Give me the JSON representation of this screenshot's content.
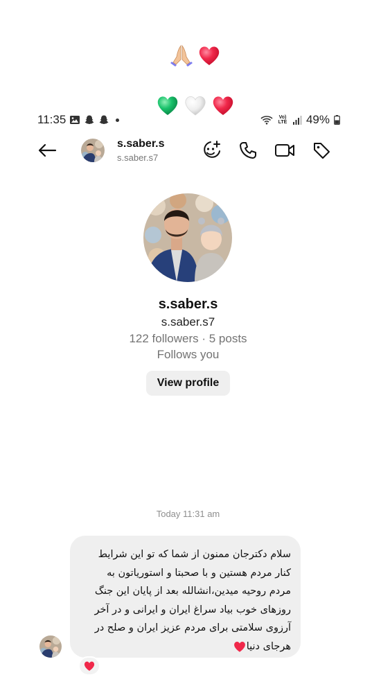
{
  "overlay": {
    "row1": [
      "folded-hands",
      "red-heart"
    ],
    "row2": [
      "green-heart",
      "white-heart",
      "red-heart"
    ]
  },
  "status_bar": {
    "time": "11:35",
    "left_icons": [
      "gallery-icon",
      "snapchat-icon",
      "snapchat-icon",
      "dot"
    ],
    "network": "Vo) LTE",
    "battery": "49%"
  },
  "header": {
    "name": "s.saber.s",
    "handle": "s.saber.s7",
    "actions": [
      "add-sticker-icon",
      "phone-icon",
      "video-icon",
      "tag-icon"
    ]
  },
  "profile": {
    "name": "s.saber.s",
    "handle": "s.saber.s7",
    "stats": "122 followers · 5 posts",
    "follows": "Follows you",
    "view_profile_label": "View profile"
  },
  "chat": {
    "timestamp": "Today 11:31 am",
    "message": "سلام دکترجان ممنون از شما که تو این شرایط کنار مردم هستین و با صحبتا و استوریاتون به مردم روحیه میدین،انشالله بعد از پایان این جنگ روزهای خوب بیاد سراغ ایران و ایرانی و در آخر آرزوی سلامتی برای مردم عزیز ایران و صلح در هرجای دنیا",
    "reaction": "red-heart"
  },
  "colors": {
    "bubble": "#efefef",
    "secondary_text": "#737373",
    "heart_red": "#f0284a",
    "heart_green": "#19c26b"
  }
}
